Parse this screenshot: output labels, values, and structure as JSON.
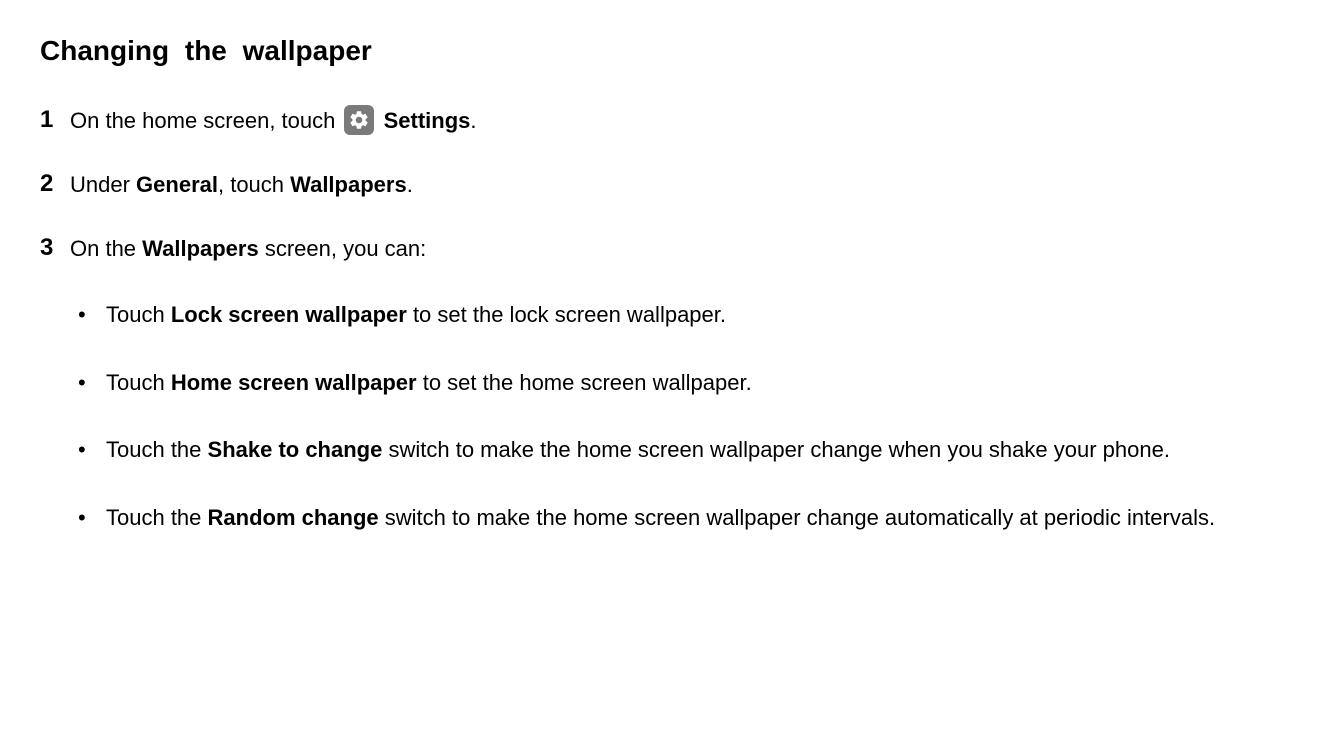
{
  "heading": "Changing the wallpaper",
  "steps": {
    "s1": {
      "num": "1",
      "pre": "On the home screen, touch ",
      "settings_label": "Settings",
      "post": "."
    },
    "s2": {
      "num": "2",
      "pre": "Under ",
      "bold1": "General",
      "mid": ", touch ",
      "bold2": "Wallpapers",
      "post": "."
    },
    "s3": {
      "num": "3",
      "pre": "On the ",
      "bold1": "Wallpapers",
      "post": " screen, you can:",
      "bullets": {
        "b1": {
          "pre": "Touch ",
          "bold": "Lock screen wallpaper",
          "post": " to set the lock screen wallpaper."
        },
        "b2": {
          "pre": "Touch ",
          "bold": "Home screen wallpaper",
          "post": " to set the home screen wallpaper."
        },
        "b3": {
          "pre": "Touch the ",
          "bold": "Shake to change",
          "post": " switch to make the home screen wallpaper change when you shake your phone."
        },
        "b4": {
          "pre": "Touch the ",
          "bold": "Random change",
          "post": " switch to make the home screen wallpaper change automatically at periodic intervals."
        }
      }
    }
  }
}
